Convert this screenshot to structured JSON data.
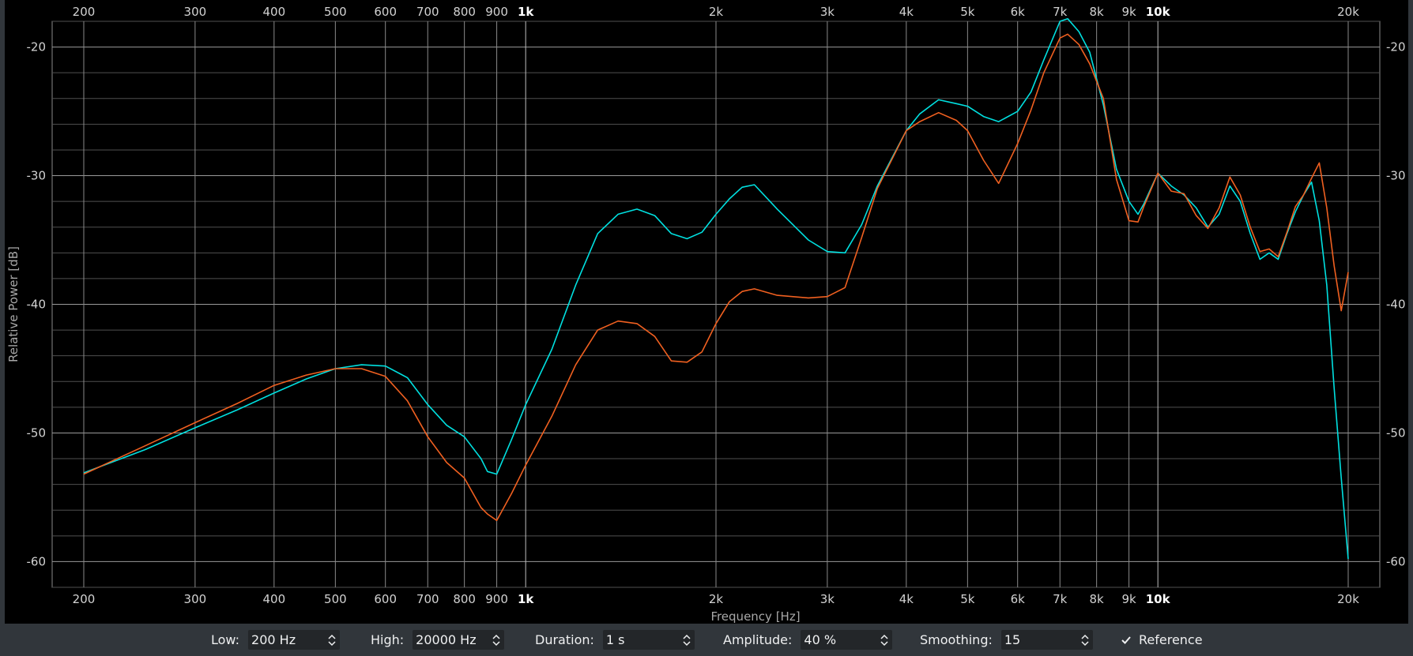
{
  "chart_data": {
    "type": "line",
    "xlabel": "Frequency [Hz]",
    "ylabel": "Relative Power [dB]",
    "xscale": "log",
    "xlim": [
      200,
      20000
    ],
    "ylim": [
      -62,
      -18
    ],
    "grid": true,
    "x_ticks": [
      {
        "value": 200,
        "label": "200"
      },
      {
        "value": 300,
        "label": "300"
      },
      {
        "value": 400,
        "label": "400"
      },
      {
        "value": 500,
        "label": "500"
      },
      {
        "value": 600,
        "label": "600"
      },
      {
        "value": 700,
        "label": "700"
      },
      {
        "value": 800,
        "label": "800"
      },
      {
        "value": 900,
        "label": "900"
      },
      {
        "value": 1000,
        "label": "1k",
        "bold": true
      },
      {
        "value": 2000,
        "label": "2k"
      },
      {
        "value": 3000,
        "label": "3k"
      },
      {
        "value": 4000,
        "label": "4k"
      },
      {
        "value": 5000,
        "label": "5k"
      },
      {
        "value": 6000,
        "label": "6k"
      },
      {
        "value": 7000,
        "label": "7k"
      },
      {
        "value": 8000,
        "label": "8k"
      },
      {
        "value": 9000,
        "label": "9k"
      },
      {
        "value": 10000,
        "label": "10k",
        "bold": true
      },
      {
        "value": 20000,
        "label": "20k"
      }
    ],
    "y_ticks": [
      {
        "value": -20,
        "label": "-20"
      },
      {
        "value": -30,
        "label": "-30"
      },
      {
        "value": -40,
        "label": "-40"
      },
      {
        "value": -50,
        "label": "-50"
      },
      {
        "value": -60,
        "label": "-60"
      }
    ],
    "series": [
      {
        "color": "#00e0e0",
        "x": [
          200,
          250,
          300,
          350,
          400,
          450,
          500,
          550,
          600,
          650,
          700,
          750,
          800,
          850,
          870,
          900,
          950,
          1000,
          1100,
          1200,
          1300,
          1400,
          1500,
          1600,
          1700,
          1800,
          1900,
          2000,
          2100,
          2200,
          2300,
          2500,
          2800,
          3000,
          3200,
          3400,
          3600,
          4000,
          4200,
          4500,
          4800,
          5000,
          5300,
          5600,
          6000,
          6300,
          6600,
          7000,
          7200,
          7500,
          7800,
          8200,
          8600,
          9000,
          9300,
          9500,
          10000,
          10500,
          11000,
          11500,
          12000,
          12500,
          13000,
          13500,
          14000,
          14500,
          15000,
          15500,
          16000,
          16500,
          17000,
          17500,
          18000,
          18500,
          19000,
          19500,
          20000
        ],
        "y": [
          -53.1,
          -51.3,
          -49.6,
          -48.2,
          -46.9,
          -45.8,
          -45.0,
          -44.7,
          -44.8,
          -45.7,
          -47.8,
          -49.4,
          -50.3,
          -52.0,
          -53.0,
          -53.2,
          -50.5,
          -47.8,
          -43.5,
          -38.5,
          -34.5,
          -33.0,
          -32.6,
          -33.1,
          -34.5,
          -34.9,
          -34.4,
          -33.0,
          -31.8,
          -30.9,
          -30.7,
          -32.6,
          -35.0,
          -35.9,
          -36.0,
          -33.8,
          -30.8,
          -26.5,
          -25.2,
          -24.1,
          -24.4,
          -24.6,
          -25.4,
          -25.8,
          -25.0,
          -23.5,
          -21.0,
          -18.0,
          -17.8,
          -18.8,
          -20.4,
          -24.5,
          -29.5,
          -32.0,
          -33.0,
          -32.2,
          -29.8,
          -30.8,
          -31.5,
          -32.5,
          -34.0,
          -33.0,
          -30.8,
          -32.0,
          -34.5,
          -36.5,
          -36.0,
          -36.5,
          -34.5,
          -32.8,
          -31.5,
          -30.5,
          -33.5,
          -38.5,
          -46.5,
          -53.5,
          -59.8
        ]
      },
      {
        "color": "#f06020",
        "x": [
          200,
          250,
          300,
          350,
          400,
          450,
          500,
          550,
          600,
          650,
          700,
          750,
          800,
          850,
          870,
          900,
          950,
          1000,
          1100,
          1200,
          1300,
          1400,
          1500,
          1600,
          1700,
          1800,
          1900,
          2000,
          2100,
          2200,
          2300,
          2500,
          2800,
          3000,
          3200,
          3400,
          3600,
          4000,
          4200,
          4500,
          4800,
          5000,
          5300,
          5600,
          6000,
          6300,
          6600,
          7000,
          7200,
          7500,
          7800,
          8200,
          8600,
          9000,
          9300,
          9500,
          10000,
          10500,
          11000,
          11500,
          12000,
          12500,
          13000,
          13500,
          14000,
          14500,
          15000,
          15500,
          16000,
          16500,
          17000,
          17500,
          18000,
          18500,
          19000,
          19500,
          20000
        ],
        "y": [
          -53.2,
          -51.0,
          -49.2,
          -47.7,
          -46.3,
          -45.5,
          -45.0,
          -45.0,
          -45.6,
          -47.5,
          -50.3,
          -52.3,
          -53.5,
          -55.8,
          -56.3,
          -56.8,
          -54.7,
          -52.5,
          -48.7,
          -44.7,
          -42.0,
          -41.3,
          -41.5,
          -42.5,
          -44.4,
          -44.5,
          -43.7,
          -41.5,
          -39.8,
          -39.0,
          -38.8,
          -39.3,
          -39.5,
          -39.4,
          -38.7,
          -34.8,
          -31.0,
          -26.5,
          -25.8,
          -25.1,
          -25.7,
          -26.5,
          -28.8,
          -30.6,
          -27.5,
          -24.9,
          -22.0,
          -19.3,
          -19.0,
          -19.8,
          -21.3,
          -24.0,
          -30.3,
          -33.5,
          -33.6,
          -32.4,
          -29.8,
          -31.2,
          -31.4,
          -33.1,
          -34.1,
          -32.5,
          -30.1,
          -31.5,
          -34.0,
          -35.9,
          -35.7,
          -36.3,
          -34.4,
          -32.4,
          -31.5,
          -30.2,
          -29.0,
          -32.5,
          -37.0,
          -40.5,
          -37.5
        ]
      }
    ]
  },
  "controls": {
    "low_label": "Low:",
    "low_value": "200 Hz",
    "high_label": "High:",
    "high_value": "20000 Hz",
    "duration_label": "Duration:",
    "duration_value": "1 s",
    "amplitude_label": "Amplitude:",
    "amplitude_value": "40 %",
    "smoothing_label": "Smoothing:",
    "smoothing_value": "15",
    "reference_label": "Reference",
    "reference_checked": true
  }
}
